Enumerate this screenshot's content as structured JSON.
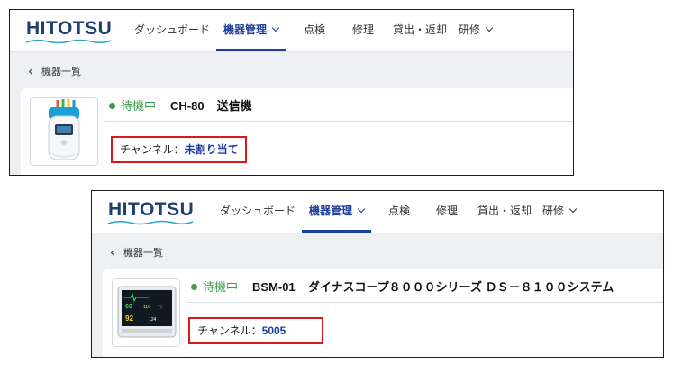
{
  "colors": {
    "brand": "#1f3f70",
    "nav_active": "#1f3f9c",
    "status_green": "#3c9a4a",
    "highlight_red": "#d7191c",
    "subheader_bg": "#eef0f3"
  },
  "screens": [
    {
      "logo": "HITOTSU",
      "nav": [
        "ダッシュボード",
        "機器管理",
        "点検",
        "修理",
        "貸出・返却",
        "研修"
      ],
      "breadcrumb": "機器一覧",
      "device": {
        "status": "待機中",
        "model": "CH-80",
        "name": "送信機",
        "image_icon": "transmitter-device-icon"
      },
      "channel": {
        "label": "チャンネル：",
        "value": "未割り当て"
      }
    },
    {
      "logo": "HITOTSU",
      "nav": [
        "ダッシュボード",
        "機器管理",
        "点検",
        "修理",
        "貸出・返却",
        "研修"
      ],
      "breadcrumb": "機器一覧",
      "device": {
        "status": "待機中",
        "model": "BSM-01",
        "name": "ダイナスコープ８０００シリーズ ＤＳ－８１００システム",
        "image_icon": "patient-monitor-icon",
        "screen_readings": [
          "60",
          "116",
          "75",
          "92",
          "124"
        ]
      },
      "channel": {
        "label": "チャンネル：",
        "value": "5005"
      }
    }
  ]
}
